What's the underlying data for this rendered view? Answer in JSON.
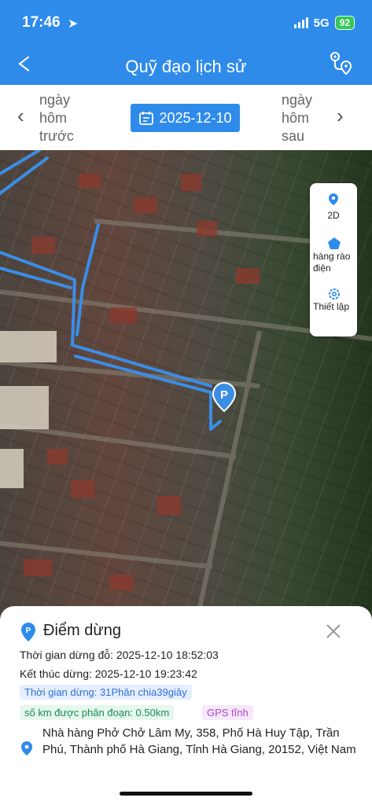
{
  "status": {
    "time": "17:46",
    "network": "5G",
    "battery": "92"
  },
  "header": {
    "title": "Quỹ đạo lịch sử"
  },
  "datebar": {
    "prev_label": "ngày\nhôm\ntrước",
    "next_label": "ngày\nhôm\nsau",
    "date": "2025-12-10"
  },
  "map_tools": {
    "view_label": "2D",
    "fence_label": "hàng rào điện",
    "settings_label": "Thiết lập"
  },
  "map_marker": {
    "label": "P"
  },
  "stop": {
    "title": "Điểm dừng",
    "start": "Thời gian dừng đỗ: 2025-12-10 18:52:03",
    "end": "Kết thúc dừng: 2025-12-10 19:23:42",
    "duration": "Thời gian dừng: 31Phân chia39giây",
    "distance": "số km được phân đoạn: 0.50km",
    "gps": "GPS tĩnh",
    "address": "Nhà hàng Phở Chở Lâm My, 358, Phố Hà Huy Tập, Trần Phú, Thành phố Hà Giang, Tỉnh Hà Giang, 20152, Việt Nam"
  },
  "colors": {
    "primary": "#2f8bea",
    "route": "#3b8de6",
    "duration_bg": "#e6efff",
    "distance_bg": "#e5f7ee",
    "gps_bg": "#f6e8fb"
  }
}
